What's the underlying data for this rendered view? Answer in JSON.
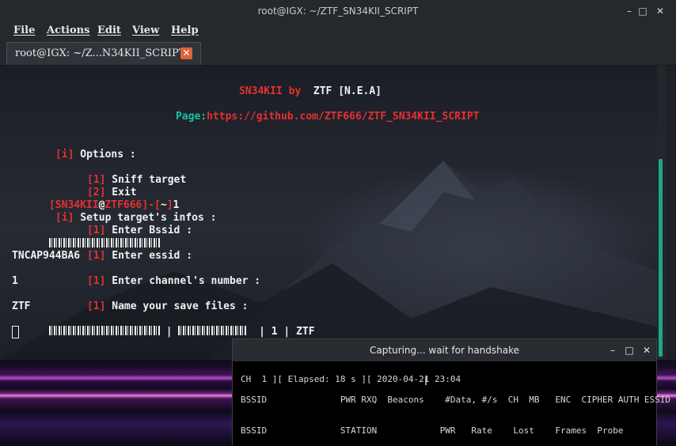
{
  "window": {
    "title": "root@IGX: ~/ZTF_SN34KII_SCRIPT",
    "minimize": "–",
    "maximize": "□",
    "close": "✕"
  },
  "menu": [
    "File",
    "Actions",
    "Edit",
    "View",
    "Help"
  ],
  "tab": {
    "label": "root@IGX: ~/Z...N34KII_SCRIPT",
    "close": "✕"
  },
  "console": {
    "banner_name": "SN34KII",
    "banner_by": " by  ",
    "banner_author": "ZTF [N.E.A]",
    "page_label": "Page:",
    "page_url": "https://github.com/ZTF666/ZTF_SN34KII_SCRIPT",
    "tag_i": "[i]",
    "options_text": " Options :",
    "tag_1": "[1]",
    "sniff_text": " Sniff target",
    "tag_2": "[2]",
    "exit_text": " Exit",
    "prompt_user": "[SN34KII",
    "prompt_at": "@",
    "prompt_host": "ZTF666",
    "prompt_sep": "]-[",
    "prompt_tilde": "~",
    "prompt_end": "]",
    "prompt_input": "1",
    "setup_text": " Setup target's infos :",
    "bssid_text": " Enter Bssid :",
    "essid_text": " Enter essid :",
    "essid_value": "TNCAP944BA6",
    "channel_text": " Enter channel's number :",
    "channel_value": "1",
    "save_text": " Name your save files :",
    "save_value": "ZTF",
    "summary_tail1": " | ",
    "summary_tail2": "  | 1 | ZTF"
  },
  "popup": {
    "title": "Capturing... wait for handshake",
    "minimize": "–",
    "maximize": "□",
    "close": "✕",
    "status_line": "CH  1 ][ Elapsed: 18 s ][ 2020-04-21 23:04",
    "ap_header": "BSSID              PWR RXQ  Beacons    #Data, #/s  CH  MB   ENC  CIPHER AUTH ESSID",
    "station_header": "BSSID              STATION            PWR   Rate    Lost    Frames  Probe"
  }
}
